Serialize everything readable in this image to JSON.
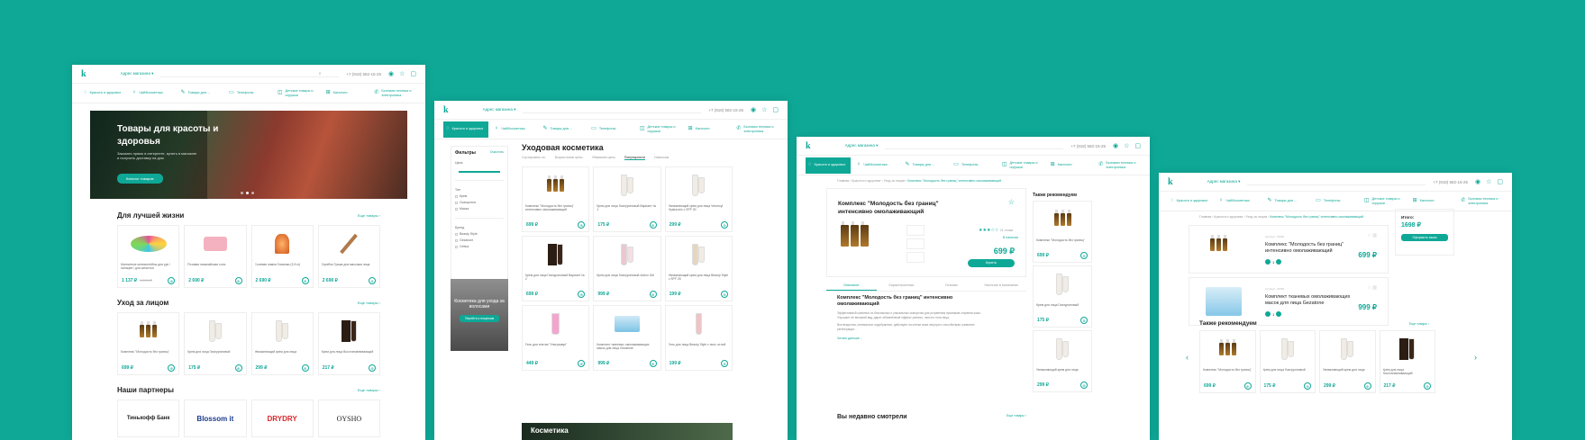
{
  "brand": {
    "logo": "k",
    "accent": "#0fa897",
    "background": "#0fa897"
  },
  "header": {
    "city": "Адрес магазина ▾",
    "phone": "+7 (918) 582-15-25",
    "search_placeholder": "Поиск"
  },
  "nav": [
    "Красота и здоровье",
    "Чай/Косметика",
    "Товары для ... ",
    "Телефоны",
    "Детские товары и игрушки",
    "Каталоги",
    "Бытовая техника и электроника"
  ],
  "p1": {
    "hero": {
      "title": "Товары для красоты и здоровья",
      "text": "Заказать прямо в интернете, купить в магазине и получить доставку на дом",
      "btn": "Каталог товаров"
    },
    "s1": {
      "title": "Для лучшей жизни",
      "more": "Еще товары ›"
    },
    "s1_items": [
      {
        "name": "Магнитные кинезиотейпы для рук / пальцев / для запястья",
        "price": "1 137 ₽",
        "old": "1 599 ₽"
      },
      {
        "name": "Розовая гималайская соль",
        "price": "2 690 ₽",
        "old": ""
      },
      {
        "name": "Солевая лампа Гималаи (3-5 кг)",
        "price": "2 690 ₽",
        "old": ""
      },
      {
        "name": "Скребок Гуаша для массажа лица",
        "price": "2 690 ₽",
        "old": ""
      }
    ],
    "s2": {
      "title": "Уход за лицом",
      "more": "Еще товары ›"
    },
    "s2_items": [
      {
        "name": "Комплекс \"Молодость без границ\"",
        "price": "699 ₽",
        "old": ""
      },
      {
        "name": "Крем для лица Гиалуроновый",
        "price": "175 ₽",
        "old": ""
      },
      {
        "name": "Увлажняющий крем для лица",
        "price": "299 ₽",
        "old": ""
      },
      {
        "name": "Крем для лица Восстанавливающий",
        "price": "217 ₽",
        "old": ""
      }
    ],
    "s3": {
      "title": "Наши партнеры",
      "more": "Еще товары ›"
    },
    "partners": [
      "Тинькофф Банк",
      "Blossom it",
      "DRYDRY",
      "OYSHO"
    ]
  },
  "p2": {
    "filters": {
      "title": "Фильтры",
      "clear": "Очистить",
      "price": "Цена",
      "type": "Тип",
      "opts": [
        "Крем",
        "Сыворотка",
        "Маска",
        "Тоник"
      ],
      "brand": "Бренд",
      "bopts": [
        "Beauty Style",
        "Gezatone",
        "Cettua"
      ],
      "promo": "Косметика для ухода за волосами",
      "promo_btn": "Перейти к покупкам"
    },
    "title": "Уходовая косметика",
    "sorts": [
      "Сортировать по:",
      "Возрастанию цены",
      "Убыванию цены",
      "Популярности",
      "Новинкам"
    ],
    "items": [
      {
        "name": "Комплекс \"Молодость без границ\" интенсивно омолаживающий",
        "price": "699 ₽"
      },
      {
        "name": "Крем для лица Гиалуроновый Вариант № 1",
        "price": "175 ₽"
      },
      {
        "name": "Увлажняющий крем для лица Vernecyl Hyaluronic c SPF 30",
        "price": "299 ₽"
      },
      {
        "name": "Крем для лица Гиалуроновый Вариант № 2",
        "price": "699 ₽"
      },
      {
        "name": "Крем для лица Гиалуроновый Action Gel",
        "price": "999 ₽"
      },
      {
        "name": "Увлажняющий крем для лица Beauty Style c SPF 25",
        "price": "199 ₽"
      },
      {
        "name": "Гель для снятия \"Ультразвук\"",
        "price": "449 ₽"
      },
      {
        "name": "Комплект тканевых омолаживающих масок для лица Gezatone",
        "price": "999 ₽"
      },
      {
        "name": "Гель для лица Beauty Style с эксп. иглой",
        "price": "199 ₽"
      }
    ],
    "band": "Косметика"
  },
  "p3": {
    "crumbs": "Главная › Красота и здоровье › Уход за лицом ›",
    "crumb_cur": "Комплекс \"Молодость без границ\" интенсивно омолаживающий",
    "title": "Комплекс \"Молодость без границ\" интенсивно омолаживающий",
    "reviews": "21 отзыв",
    "avail": "В наличии",
    "price": "699 ₽",
    "buy": "Купить",
    "tabs": [
      "Описание",
      "Характеристики",
      "Отзывы",
      "Наличие в магазинах"
    ],
    "desc_title": "Комплекс \"Молодость без границ\" интенсивно омолаживающий",
    "desc1": "Эффективный комплекс из безопасных и уникальных сыворотки для устранения признаков старения кожи. Улучшает её внешний вид, дарит обновлённый эффект ровного, чистого тона лица.",
    "desc2": "Все вещества, оптимально подобранные, действуют на клетки кожи изнутри и способствуют развитию регенерации...",
    "more": "Читать дальше...",
    "also": "Также рекомендуем",
    "side": [
      {
        "name": "Комплекс \"Молодость без границ\"",
        "price": "699 ₽"
      },
      {
        "name": "Крем для лица Гиалуроновый",
        "price": "175 ₽"
      },
      {
        "name": "Увлажняющий крем для лица",
        "price": "299 ₽"
      }
    ],
    "recent": "Вы недавно смотрели",
    "recent_more": "Еще товары ›"
  },
  "p4": {
    "items": [
      {
        "sub": "Артикул: 34890",
        "name": "Комплекс \"Молодость без границ\" интенсивно омолаживающий",
        "price": "699 ₽",
        "qty": "1"
      },
      {
        "sub": "Артикул: 34950",
        "name": "Комплект тканевых омолаживающих масок для лица Gezatone",
        "price": "999 ₽",
        "qty": "1"
      }
    ],
    "total_label": "Итого:",
    "total": "1698 ₽",
    "checkout": "Оформить заказ",
    "rec": "Также рекомендуем",
    "rec_more": "Еще товары ›",
    "rec_items": [
      {
        "name": "Комплекс \"Молодость без границ\"",
        "price": "699 ₽"
      },
      {
        "name": "Крем для лица Гиалуроновый",
        "price": "175 ₽"
      },
      {
        "name": "Увлажняющий крем для лица",
        "price": "299 ₽"
      },
      {
        "name": "Крем для лица Восстанавливающий",
        "price": "217 ₽"
      }
    ]
  }
}
